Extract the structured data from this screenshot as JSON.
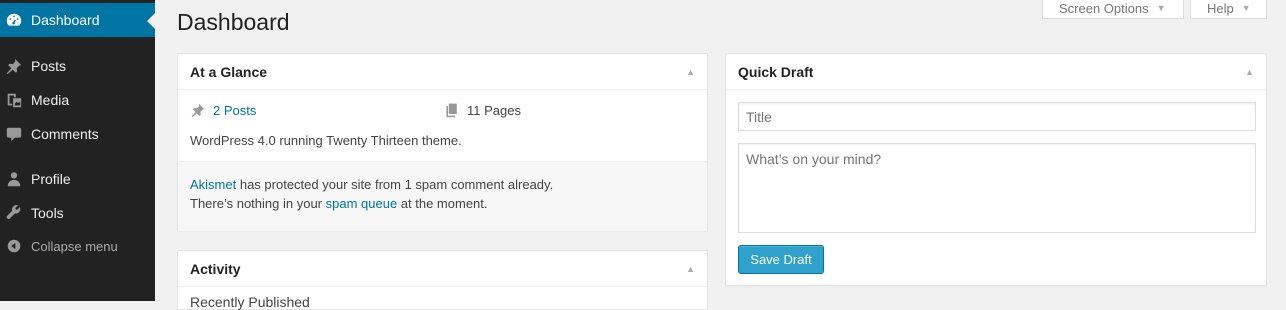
{
  "sidebar": {
    "items": [
      {
        "label": "Dashboard",
        "icon": "dashboard-icon",
        "active": true
      },
      {
        "label": "Posts",
        "icon": "pushpin-icon"
      },
      {
        "label": "Media",
        "icon": "media-icon"
      },
      {
        "label": "Comments",
        "icon": "comment-icon"
      },
      {
        "label": "Profile",
        "icon": "user-icon"
      },
      {
        "label": "Tools",
        "icon": "wrench-icon"
      }
    ],
    "collapse_label": "Collapse menu"
  },
  "header": {
    "title": "Dashboard",
    "screen_options_label": "Screen Options",
    "help_label": "Help"
  },
  "at_a_glance": {
    "title": "At a Glance",
    "posts_label": "2 Posts",
    "pages_label": "11 Pages",
    "version_text": "WordPress 4.0 running Twenty Thirteen theme.",
    "akismet_link": "Akismet",
    "akismet_text": " has protected your site from 1 spam comment already.",
    "spam_prefix": "There’s nothing in your ",
    "spam_link": "spam queue",
    "spam_suffix": " at the moment."
  },
  "activity": {
    "title": "Activity",
    "subheading": "Recently Published"
  },
  "quick_draft": {
    "title": "Quick Draft",
    "title_placeholder": "Title",
    "content_placeholder": "What’s on your mind?",
    "save_label": "Save Draft"
  },
  "colors": {
    "accent": "#0074a2",
    "sidebar_bg": "#222222",
    "button": "#2ea2cc"
  }
}
